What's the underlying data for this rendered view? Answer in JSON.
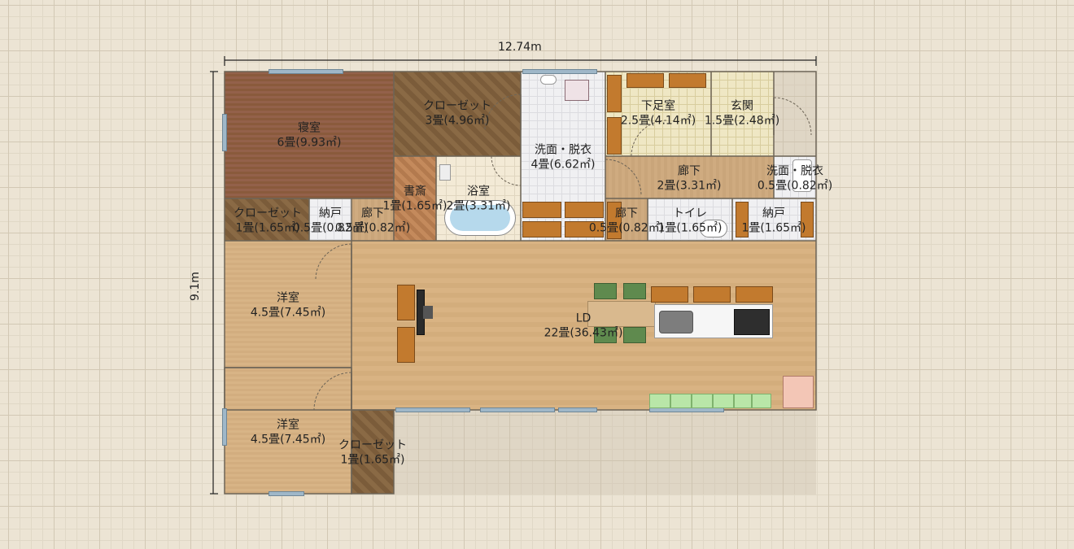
{
  "dimensions": {
    "width_label": "12.74m",
    "height_label": "9.1m"
  },
  "rooms": {
    "bedroom": {
      "name": "寝室",
      "size": "6畳(9.93㎡)"
    },
    "closet_top": {
      "name": "クローゼット",
      "size": "3畳(4.96㎡)"
    },
    "washroom_main": {
      "name": "洗面・脱衣",
      "size": "4畳(6.62㎡)"
    },
    "shoe_room": {
      "name": "下足室",
      "size": "2.5畳(4.14㎡)"
    },
    "entrance": {
      "name": "玄関",
      "size": "1.5畳(2.48㎡)"
    },
    "corridor_right": {
      "name": "廊下",
      "size": "2畳(3.31㎡)"
    },
    "washroom_small": {
      "name": "洗面・脱衣",
      "size": "0.5畳(0.82㎡)"
    },
    "study": {
      "name": "書斎",
      "size": "1畳(1.65㎡)"
    },
    "bath": {
      "name": "浴室",
      "size": "2畳(3.31㎡)"
    },
    "closet_mid": {
      "name": "クローゼット",
      "size": "1畳(1.65㎡)"
    },
    "storage_small": {
      "name": "納戸",
      "size": "0.5畳(0.82㎡)"
    },
    "corridor_small": {
      "name": "廊下",
      "size": "0.5畳(0.82㎡)"
    },
    "corridor_mid": {
      "name": "廊下",
      "size": "0.5畳(0.82㎡)"
    },
    "toilet": {
      "name": "トイレ",
      "size": "1畳(1.65㎡)"
    },
    "storage_right": {
      "name": "納戸",
      "size": "1畳(1.65㎡)"
    },
    "western1": {
      "name": "洋室",
      "size": "4.5畳(7.45㎡)"
    },
    "western2": {
      "name": "洋室",
      "size": "4.5畳(7.45㎡)"
    },
    "ld": {
      "name": "LD",
      "size": "22畳(36.43㎡)"
    },
    "closet_bottom": {
      "name": "クローゼット",
      "size": "1畳(1.65㎡)"
    }
  }
}
